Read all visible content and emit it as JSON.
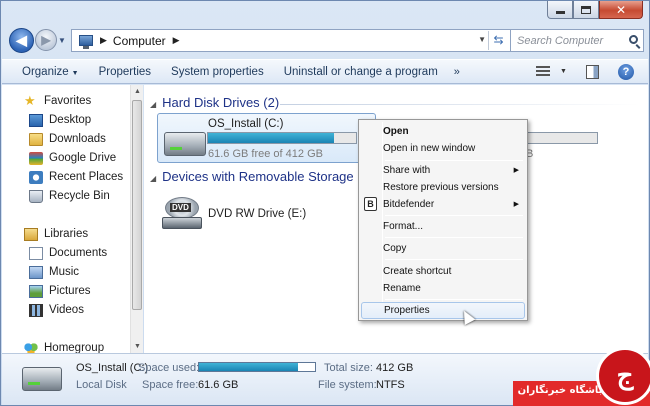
{
  "address": {
    "path": [
      "Computer"
    ],
    "search_placeholder": "Search Computer"
  },
  "toolbar": {
    "organize": "Organize",
    "properties": "Properties",
    "system_properties": "System properties",
    "uninstall": "Uninstall or change a program",
    "more": "»"
  },
  "nav": {
    "favorites": "Favorites",
    "desktop": "Desktop",
    "downloads": "Downloads",
    "google_drive": "Google Drive",
    "recent_places": "Recent Places",
    "recycle_bin": "Recycle Bin",
    "libraries": "Libraries",
    "documents": "Documents",
    "music": "Music",
    "pictures": "Pictures",
    "videos": "Videos",
    "homegroup": "Homegroup"
  },
  "content": {
    "hdd_group": "Hard Disk Drives (2)",
    "removable_group": "Devices with Removable Storage (1",
    "drive_c": {
      "name": "OS_Install (C:)",
      "free": "61.6 GB free of 412 GB",
      "used_fraction": 0.85
    },
    "hidden_drive_free_fragment": "B",
    "dvd": {
      "name": "DVD RW Drive (E:)",
      "badge": "DVD"
    }
  },
  "context_menu": {
    "open": "Open",
    "open_new_window": "Open in new window",
    "share_with": "Share with",
    "restore_versions": "Restore previous versions",
    "bitdefender": "Bitdefender",
    "format": "Format...",
    "copy": "Copy",
    "create_shortcut": "Create shortcut",
    "rename": "Rename",
    "properties": "Properties"
  },
  "details": {
    "name": "OS_Install (C:)",
    "type": "Local Disk",
    "space_used_label": "Space used:",
    "space_used_fraction": 0.85,
    "space_free_label": "Space free:",
    "space_free": "61.6 GB",
    "total_size_label": "Total size:",
    "total_size": "412 GB",
    "fs_label": "File system:",
    "fs": "NTFS"
  },
  "watermark": {
    "text": "باشگاه خبرنگاران",
    "glyph": "ج"
  },
  "colors": {
    "accent": "#1e3287",
    "selection": "#d9e9f9",
    "watermark_red": "#e22a2a"
  }
}
